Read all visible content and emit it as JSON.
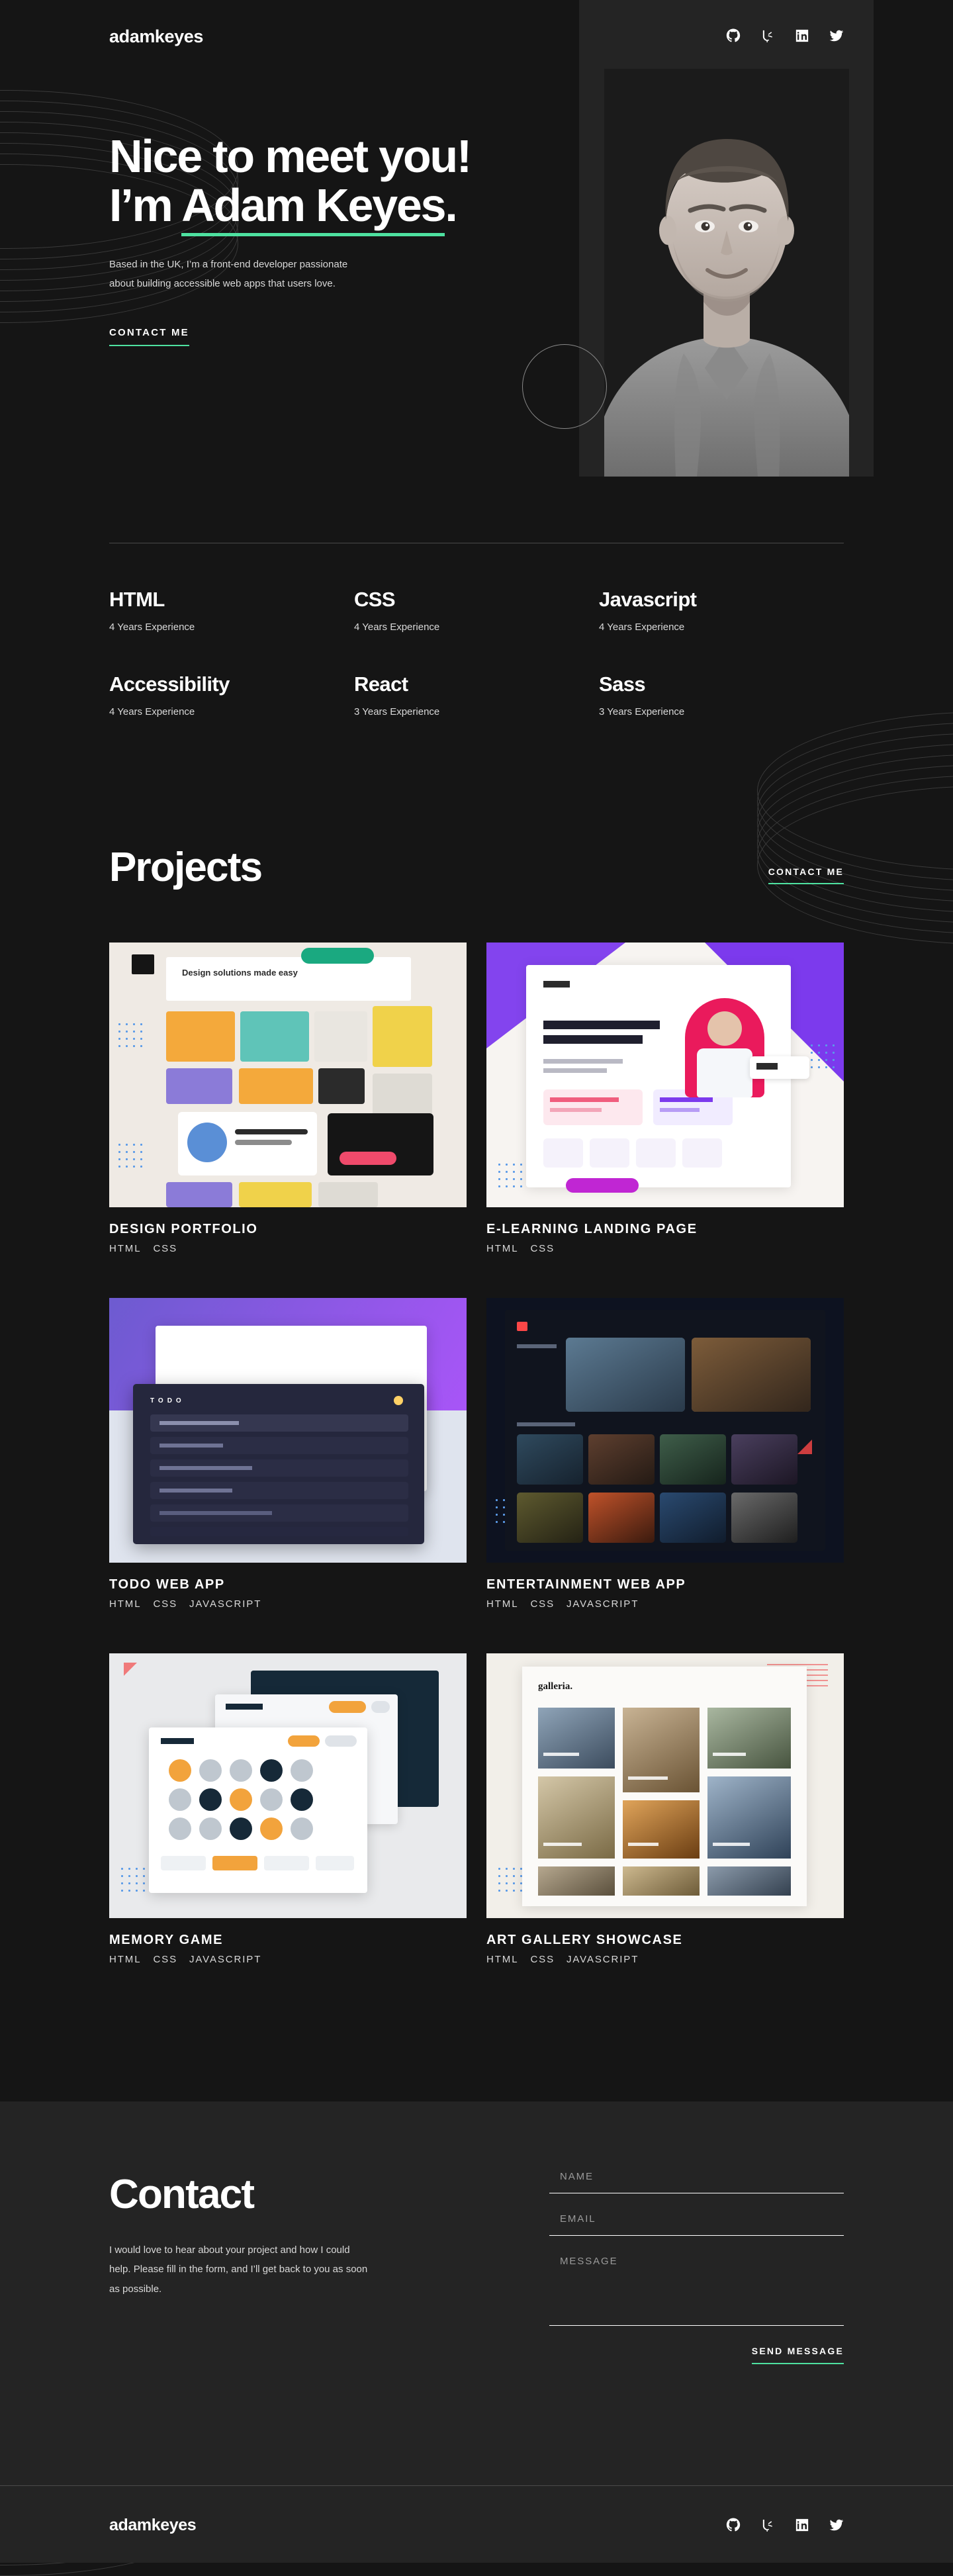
{
  "theme": {
    "background": "#151515",
    "surface": "#242424",
    "accent": "#4EE1A0",
    "text": "#FFFFFF",
    "muted": "#D9D9D9"
  },
  "header": {
    "logo": "adamkeyes",
    "socials": [
      {
        "name": "github-icon",
        "label": "GitHub"
      },
      {
        "name": "frontend-mentor-icon",
        "label": "Frontend Mentor"
      },
      {
        "name": "linkedin-icon",
        "label": "LinkedIn"
      },
      {
        "name": "twitter-icon",
        "label": "Twitter"
      }
    ]
  },
  "hero": {
    "title_line1": "Nice to meet you!",
    "title_line2_prefix": "I’m ",
    "title_line2_name": "Adam Keyes",
    "title_line2_suffix": ".",
    "body": "Based in the UK, I’m a front-end developer passionate about building accessible web apps that users love.",
    "cta": "Contact me",
    "portrait_alt": "Portrait of Adam Keyes"
  },
  "skills": {
    "items": [
      {
        "name": "HTML",
        "experience": "4 Years Experience"
      },
      {
        "name": "CSS",
        "experience": "4 Years Experience"
      },
      {
        "name": "Javascript",
        "experience": "4 Years Experience"
      },
      {
        "name": "Accessibility",
        "experience": "4 Years Experience"
      },
      {
        "name": "React",
        "experience": "3 Years Experience"
      },
      {
        "name": "Sass",
        "experience": "3 Years Experience"
      }
    ]
  },
  "projects": {
    "title": "Projects",
    "cta": "Contact me",
    "items": [
      {
        "name": "Design Portfolio",
        "tags": [
          "HTML",
          "CSS"
        ]
      },
      {
        "name": "E-Learning Landing Page",
        "tags": [
          "HTML",
          "CSS"
        ]
      },
      {
        "name": "Todo Web App",
        "tags": [
          "HTML",
          "CSS",
          "JAVASCRIPT"
        ]
      },
      {
        "name": "Entertainment Web App",
        "tags": [
          "HTML",
          "CSS",
          "JAVASCRIPT"
        ]
      },
      {
        "name": "Memory Game",
        "tags": [
          "HTML",
          "CSS",
          "JAVASCRIPT"
        ]
      },
      {
        "name": "Art Gallery Showcase",
        "tags": [
          "HTML",
          "CSS",
          "JAVASCRIPT"
        ]
      }
    ]
  },
  "contact": {
    "title": "Contact",
    "body": "I would love to hear about your project and how I could help. Please fill in the form, and I’ll get back to you as soon as possible.",
    "form": {
      "name_placeholder": "NAME",
      "name_value": "",
      "email_placeholder": "EMAIL",
      "email_value": "",
      "message_placeholder": "MESSAGE",
      "message_value": "",
      "submit": "Send message"
    }
  },
  "footer": {
    "logo": "adamkeyes",
    "socials": [
      {
        "name": "github-icon",
        "label": "GitHub"
      },
      {
        "name": "frontend-mentor-icon",
        "label": "Frontend Mentor"
      },
      {
        "name": "linkedin-icon",
        "label": "LinkedIn"
      },
      {
        "name": "twitter-icon",
        "label": "Twitter"
      }
    ]
  }
}
